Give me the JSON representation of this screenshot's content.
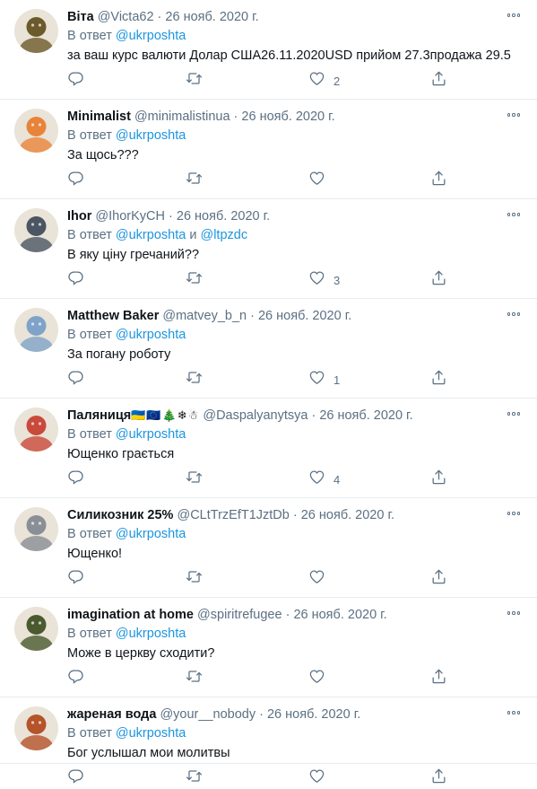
{
  "reply_prefix": "В ответ",
  "and_word": "и",
  "tweets": [
    {
      "name": "Віта",
      "handle": "@Victa62",
      "date": "26 нояб. 2020 г.",
      "mentions": [
        "@ukrposhta"
      ],
      "text": "за ваш курс валюти Долар США26.11.2020USD прийом 27.3продажа 29.5",
      "likes": "2",
      "avatar_color": "#6b5a2a"
    },
    {
      "name": "Minimalist",
      "handle": "@minimalistinua",
      "date": "26 нояб. 2020 г.",
      "mentions": [
        "@ukrposhta"
      ],
      "text": "За щось???",
      "likes": "",
      "avatar_color": "#e8843a"
    },
    {
      "name": "Ihor",
      "handle": "@IhorKyCH",
      "date": "26 нояб. 2020 г.",
      "mentions": [
        "@ukrposhta",
        "@ltpzdc"
      ],
      "text": "В яку ціну гречаний??",
      "likes": "3",
      "avatar_color": "#4b5563"
    },
    {
      "name": "Matthew Baker",
      "handle": "@matvey_b_n",
      "date": "26 нояб. 2020 г.",
      "mentions": [
        "@ukrposhta"
      ],
      "text": "За погану роботу",
      "likes": "1",
      "avatar_color": "#7fa3c8"
    },
    {
      "name": "Паляниця",
      "handle": "@Daspalyanytsya",
      "date": "26 нояб. 2020 г.",
      "emojis": "🇺🇦🇪🇺🎄❄☃",
      "mentions": [
        "@ukrposhta"
      ],
      "text": "Ющенко грається",
      "likes": "4",
      "avatar_color": "#c94a3a"
    },
    {
      "name": "Силикозник 25%",
      "handle": "@CLtTrzEfT1JztDb",
      "date": "26 нояб. 2020 г.",
      "mentions": [
        "@ukrposhta"
      ],
      "text": "Ющенко!",
      "likes": "",
      "avatar_color": "#8a8f96"
    },
    {
      "name": "imagination at home",
      "handle": "@spiritrefugee",
      "date": "26 нояб. 2020 г.",
      "mentions": [
        "@ukrposhta"
      ],
      "text": "Може в церкву сходити?",
      "likes": "",
      "avatar_color": "#4a5a2e"
    },
    {
      "name": "жареная вода",
      "handle": "@your__nobody",
      "date": "26 нояб. 2020 г.",
      "mentions": [
        "@ukrposhta"
      ],
      "text": "Бог услышал мои молитвы",
      "likes": "",
      "avatar_color": "#b5532a"
    }
  ],
  "colors": {
    "link": "#1b95e0",
    "muted": "#5b7083",
    "text": "#0f1419",
    "divider": "#e6ecf0"
  }
}
